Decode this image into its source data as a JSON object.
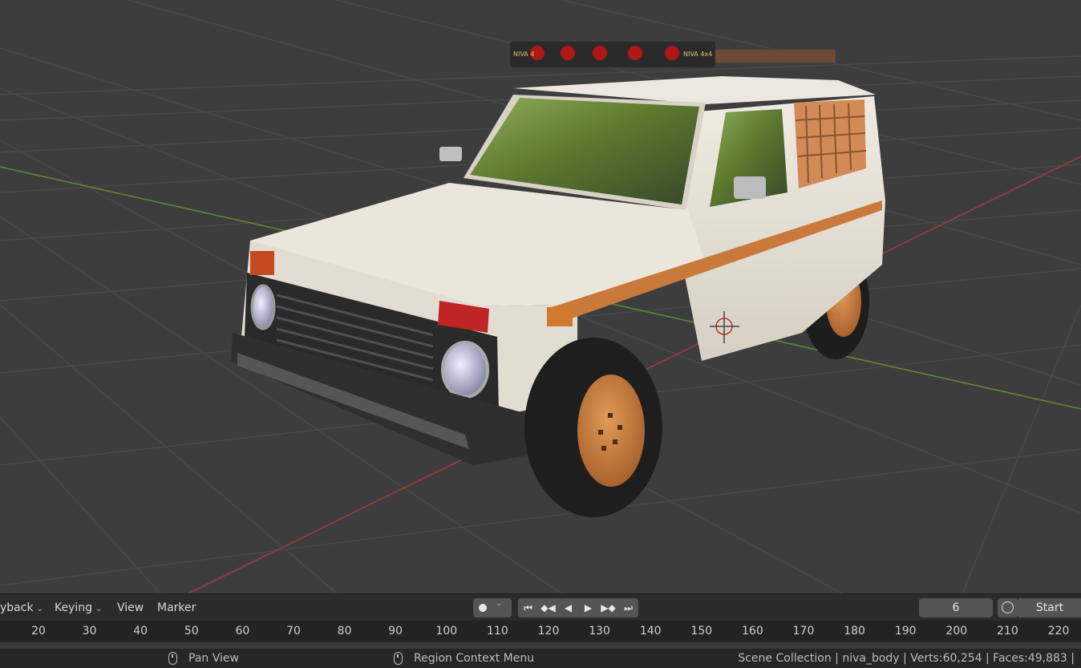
{
  "timeline": {
    "menu": [
      {
        "label": "yback",
        "has_dropdown": true
      },
      {
        "label": "Keying",
        "has_dropdown": true
      },
      {
        "label": "View",
        "has_dropdown": false
      },
      {
        "label": "Marker",
        "has_dropdown": false
      }
    ],
    "record_icon": "record-dot-icon",
    "playback_icons": [
      "jump-to-start-icon",
      "jump-keyframe-back-icon",
      "play-reverse-icon",
      "play-icon",
      "jump-keyframe-forward-icon",
      "jump-to-end-icon"
    ],
    "current_frame": "6",
    "start_label": "Start",
    "ruler_ticks": [
      "20",
      "30",
      "40",
      "50",
      "60",
      "70",
      "80",
      "90",
      "100",
      "110",
      "120",
      "130",
      "140",
      "150",
      "160",
      "170",
      "180",
      "190",
      "200",
      "210",
      "220"
    ]
  },
  "status": {
    "left_hint": "Pan View",
    "middle_hint": "Region Context Menu",
    "scene_info": "Scene Collection | niva_body | Verts:60,254 | Faces:49,883 |"
  },
  "car": {
    "badge_left": "NIVA 4",
    "badge_right": "NIVA 4x4"
  },
  "colors": {
    "viewport_bg": "#3d3d3d",
    "grid_line": "#4a4a4a",
    "x_axis": "#a03a3f",
    "y_axis": "#5d8a2c",
    "body_paint": "#e6e1d6",
    "stripe": "#c97a3a",
    "wheel_rim": "#c9803f"
  }
}
